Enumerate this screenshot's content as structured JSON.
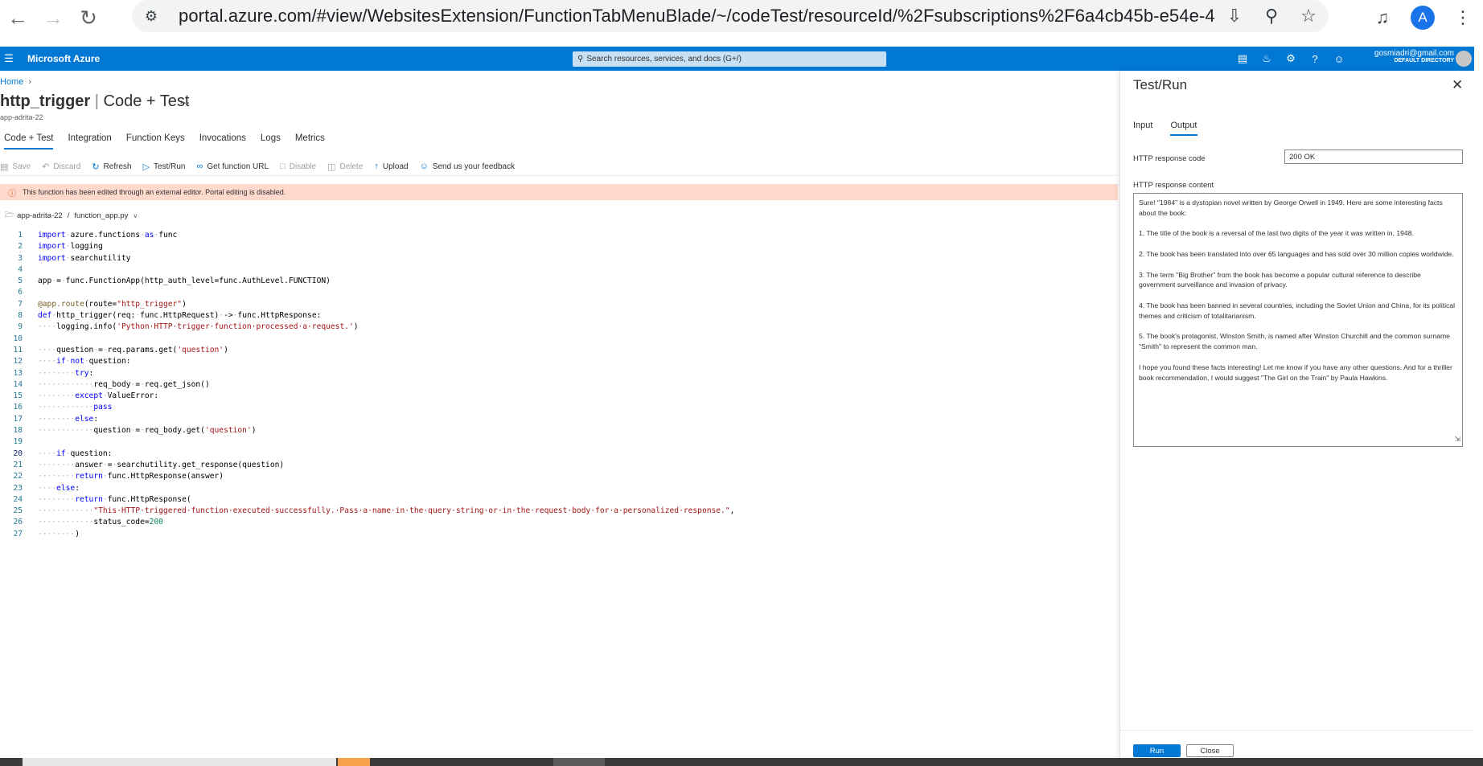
{
  "browser": {
    "url": "portal.azure.com/#view/WebsitesExtension/FunctionTabMenuBlade/~/codeTest/resourceId/%2Fsubscriptions%2F6a4cb45b-e54e-4b04-...",
    "profile_initial": "A"
  },
  "azure": {
    "brand": "Microsoft Azure",
    "search_placeholder": "Search resources, services, and docs (G+/)",
    "account_email": "gosmiadri@gmail.com",
    "account_directory": "DEFAULT DIRECTORY"
  },
  "breadcrumb": {
    "home": "Home"
  },
  "page": {
    "title_bold": "http_trigger",
    "title_sep": "|",
    "title_rest": "Code + Test",
    "more": "...",
    "subtitle": "app-adrita-22"
  },
  "tabs": [
    "Code + Test",
    "Integration",
    "Function Keys",
    "Invocations",
    "Logs",
    "Metrics"
  ],
  "toolbar": {
    "save": "Save",
    "discard": "Discard",
    "refresh": "Refresh",
    "test_run": "Test/Run",
    "get_url": "Get function URL",
    "disable": "Disable",
    "delete": "Delete",
    "upload": "Upload",
    "feedback": "Send us your feedback"
  },
  "warning": "This function has been edited through an external editor. Portal editing is disabled.",
  "filepath": {
    "app": "app-adrita-22",
    "sep": "/",
    "file": "function_app.py"
  },
  "code_lines": [
    "import azure.functions as func",
    "import logging",
    "import searchutility",
    "",
    "app = func.FunctionApp(http_auth_level=func.AuthLevel.FUNCTION)",
    "",
    "@app.route(route=\"http_trigger\")",
    "def http_trigger(req: func.HttpRequest) -> func.HttpResponse:",
    "    logging.info('Python HTTP trigger function processed a request.')",
    "",
    "    question = req.params.get('question')",
    "    if not question:",
    "        try:",
    "            req_body = req.get_json()",
    "        except ValueError:",
    "            pass",
    "        else:",
    "            question = req_body.get('question')",
    "",
    "    if question:",
    "        answer = searchutility.get_response(question)",
    "        return func.HttpResponse(answer)",
    "    else:",
    "        return func.HttpResponse(",
    "            \"This HTTP triggered function executed successfully. Pass a name in the query string or in the request body for a personalized response.\",",
    "            status_code=200",
    "        )"
  ],
  "panel": {
    "title": "Test/Run",
    "tab_input": "Input",
    "tab_output": "Output",
    "response_code_label": "HTTP response code",
    "response_code_value": "200 OK",
    "response_content_label": "HTTP response content",
    "response_paragraphs": [
      "Sure! \"1984\" is a dystopian novel written by George Orwell in 1949. Here are some interesting facts about the book:",
      "1. The title of the book is a reversal of the last two digits of the year it was written in, 1948.",
      "2. The book has been translated into over 65 languages and has sold over 30 million copies worldwide.",
      "3. The term \"Big Brother\" from the book has become a popular cultural reference to describe government surveillance and invasion of privacy.",
      "4. The book has been banned in several countries, including the Soviet Union and China, for its political themes and criticism of totalitarianism.",
      "5. The book's protagonist, Winston Smith, is named after Winston Churchill and the common surname \"Smith\" to represent the common man.",
      "I hope you found these facts interesting! Let me know if you have any other questions. And for a thriller book recommendation, I would suggest \"The Girl on the Train\" by Paula Hawkins."
    ],
    "run_label": "Run",
    "close_label": "Close"
  },
  "colors": {
    "azure_blue": "#0078d4",
    "warning_bg": "#fed9cc"
  }
}
